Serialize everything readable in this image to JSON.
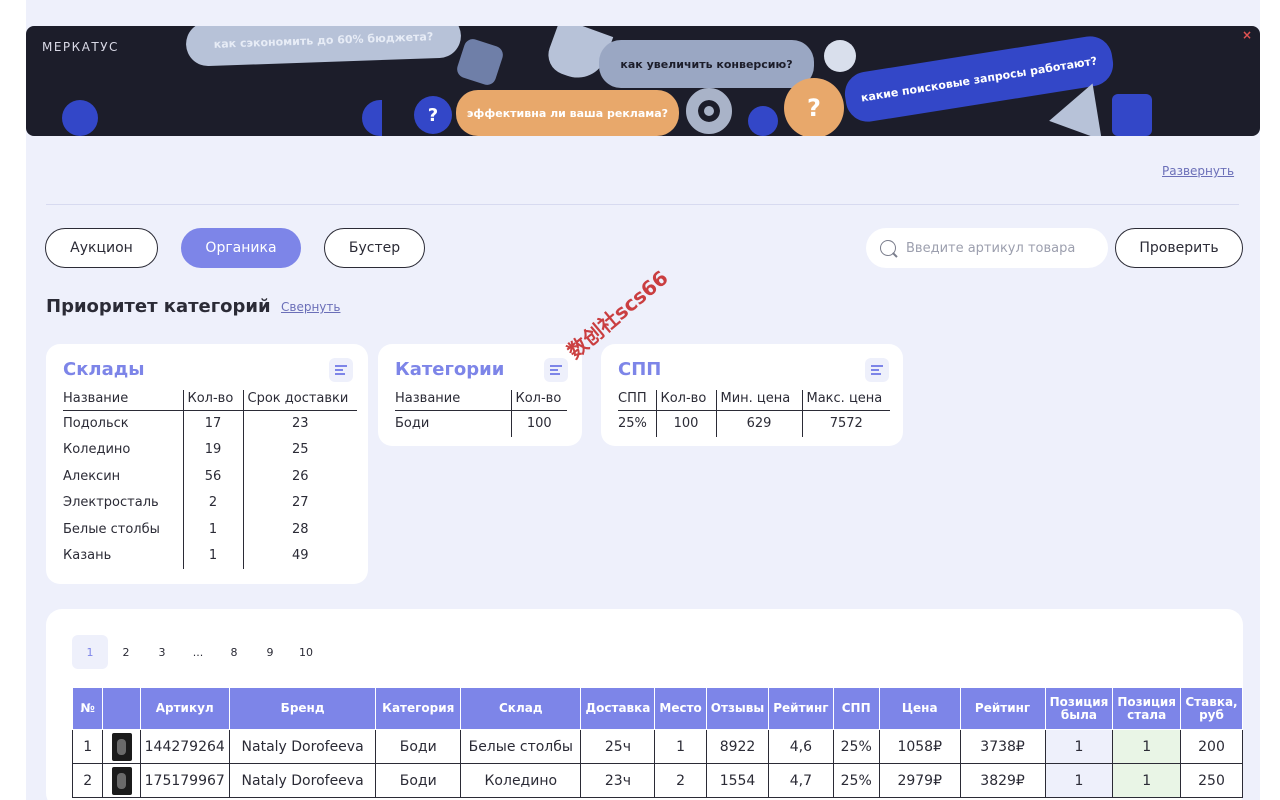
{
  "banner": {
    "logo": "МЕРКАТУС",
    "bubbles": [
      "как сэкономить до 60% бюджета?",
      "как увеличить конверсию?",
      "эффективна ли ваша реклама?",
      "какие поисковые запросы работают?"
    ],
    "question_mark": "?",
    "close": "×"
  },
  "expand_link": "Развернуть",
  "tabs": [
    {
      "label": "Аукцион",
      "active": false
    },
    {
      "label": "Органика",
      "active": true
    },
    {
      "label": "Бустер",
      "active": false
    }
  ],
  "search": {
    "placeholder": "Введите артикул товара",
    "value": ""
  },
  "check_button": "Проверить",
  "priority": {
    "title": "Приоритет категорий",
    "collapse_link": "Свернуть"
  },
  "warehouses": {
    "title": "Склады",
    "headers": [
      "Название",
      "Кол-во",
      "Срок доставки"
    ],
    "rows": [
      [
        "Подольск",
        "17",
        "23"
      ],
      [
        "Коледино",
        "19",
        "25"
      ],
      [
        "Алексин",
        "56",
        "26"
      ],
      [
        "Электросталь",
        "2",
        "27"
      ],
      [
        "Белые столбы",
        "1",
        "28"
      ],
      [
        "Казань",
        "1",
        "49"
      ]
    ]
  },
  "categories": {
    "title": "Категории",
    "headers": [
      "Название",
      "Кол-во"
    ],
    "rows": [
      [
        "Боди",
        "100"
      ]
    ]
  },
  "spp": {
    "title": "СПП",
    "headers": [
      "СПП",
      "Кол-во",
      "Мин. цена",
      "Макс. цена"
    ],
    "rows": [
      [
        "25%",
        "100",
        "629",
        "7572"
      ]
    ]
  },
  "pager": {
    "pages": [
      "1",
      "2",
      "3",
      "...",
      "8",
      "9",
      "10"
    ],
    "current": "1"
  },
  "table": {
    "headers": [
      "№",
      "",
      "Артикул",
      "Бренд",
      "Категория",
      "Склад",
      "Доставка",
      "Место",
      "Отзывы",
      "Рейтинг",
      "СПП",
      "Цена",
      "Рейтинг",
      "Позиция была",
      "Позиция стала",
      "Ставка, руб"
    ],
    "rows": [
      [
        "1",
        "",
        "144279264",
        "Nataly Dorofeeva",
        "Боди",
        "Белые столбы",
        "25ч",
        "1",
        "8922",
        "4,6",
        "25%",
        "1058₽",
        "3738₽",
        "1",
        "1",
        "200"
      ],
      [
        "2",
        "",
        "175179967",
        "Nataly Dorofeeva",
        "Боди",
        "Коледино",
        "23ч",
        "2",
        "1554",
        "4,7",
        "25%",
        "2979₽",
        "3829₽",
        "1",
        "1",
        "250"
      ]
    ]
  },
  "watermark": "数创社scs66",
  "colors": {
    "accent": "#7d85e8",
    "page_bg": "#eef0fb",
    "banner_bg": "#1c1d2a"
  }
}
